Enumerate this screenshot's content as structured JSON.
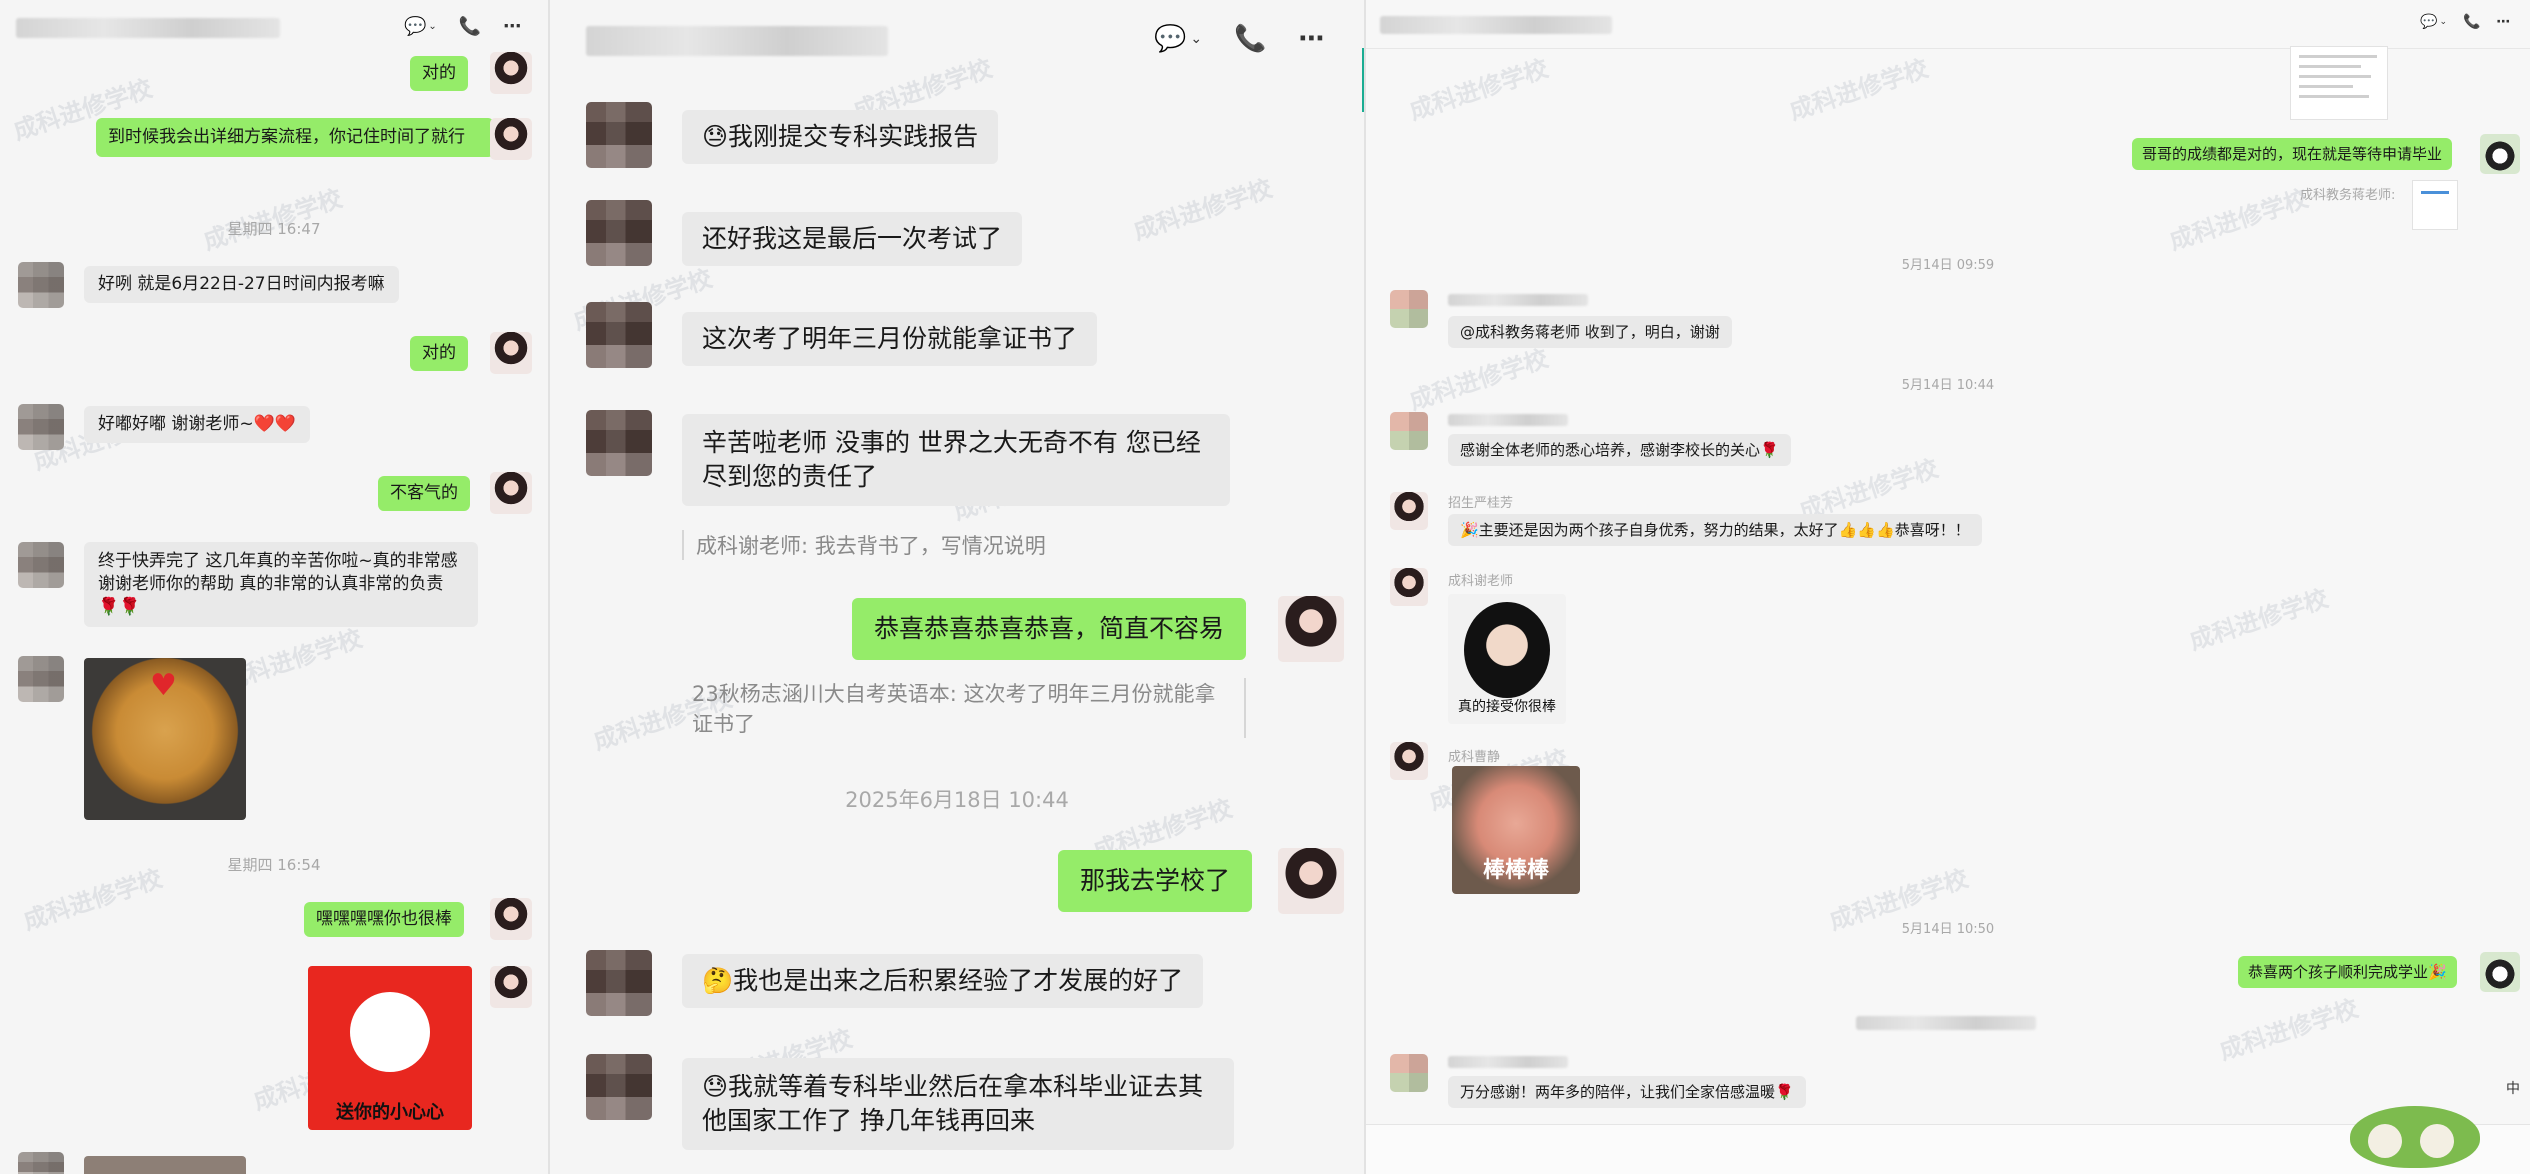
{
  "left_chat": {
    "messages": [
      {
        "dir": "out",
        "text": "对的"
      },
      {
        "dir": "out",
        "text": "到时候我会出详细方案流程，你记住时间了就行"
      },
      {
        "dir": "ts",
        "text": "星期四 16:47"
      },
      {
        "dir": "in",
        "text": "好咧 就是6月22日-27日时间内报考嘛"
      },
      {
        "dir": "out",
        "text": "对的"
      },
      {
        "dir": "in",
        "text": "好嘟好嘟 谢谢老师~❤️❤️"
      },
      {
        "dir": "out",
        "text": "不客气的"
      },
      {
        "dir": "in",
        "text": "终于快弄完了 这几年真的辛苦你啦~真的非常感谢谢老师你的帮助 真的非常的认真非常的负责🌹🌹"
      },
      {
        "dir": "ts",
        "text": "星期四 16:54"
      },
      {
        "dir": "out",
        "text": "嘿嘿嘿嘿你也很棒"
      }
    ],
    "sticker_caption": "送你的小心心"
  },
  "middle_chat": {
    "messages": [
      {
        "dir": "in",
        "text": "😓我刚提交专科实践报告"
      },
      {
        "dir": "in",
        "text": "还好我这是最后一次考试了"
      },
      {
        "dir": "in",
        "text": "这次考了明年三月份就能拿证书了"
      },
      {
        "dir": "in",
        "text": "辛苦啦老师 没事的 世界之大无奇不有 您已经尽到您的责任了"
      },
      {
        "dir": "quote",
        "text": "成科谢老师: 我去背书了，写情况说明"
      },
      {
        "dir": "out",
        "text": "恭喜恭喜恭喜恭喜，简直不容易"
      },
      {
        "dir": "quote",
        "text": "23秋杨志涵川大自考英语本: 这次考了明年三月份就能拿证书了"
      },
      {
        "dir": "ts",
        "text": "2025年6月18日 10:44"
      },
      {
        "dir": "out",
        "text": "那我去学校了"
      },
      {
        "dir": "in",
        "text": "🤔我也是出来之后积累经验了才发展的好了"
      },
      {
        "dir": "in",
        "text": "😓我就等着专科毕业然后在拿本科毕业证去其他国家工作了 挣几年钱再回来"
      }
    ]
  },
  "right_chat": {
    "messages": [
      {
        "dir": "out",
        "text": "哥哥的成绩都是对的，现在就是等待申请毕业"
      },
      {
        "dir": "name",
        "text": "成科教务蒋老师:"
      },
      {
        "dir": "ts",
        "text": "5月14日 09:59"
      },
      {
        "dir": "in",
        "text": "@成科教务蒋老师 收到了，明白，谢谢"
      },
      {
        "dir": "ts",
        "text": "5月14日 10:44"
      },
      {
        "dir": "in",
        "text": "感谢全体老师的悉心培养，感谢李校长的关心🌹"
      },
      {
        "dir": "name",
        "text": "招生严桂芳"
      },
      {
        "dir": "in",
        "text": "🎉主要还是因为两个孩子自身优秀，努力的结果，太好了👍👍👍恭喜呀！！"
      },
      {
        "dir": "name",
        "text": "成科谢老师"
      },
      {
        "dir": "sticker",
        "text": "真的接受你很棒"
      },
      {
        "dir": "name",
        "text": "成科曹静"
      },
      {
        "dir": "sticker",
        "text": "棒棒棒"
      },
      {
        "dir": "ts",
        "text": "5月14日 10:50"
      },
      {
        "dir": "out",
        "text": "恭喜两个孩子顺利完成学业🎉"
      },
      {
        "dir": "in",
        "text": "万分感谢！两年多的陪伴，让我们全家倍感温暖🌹"
      }
    ],
    "ime_indicator": "中"
  },
  "watermark": "成科进修学校",
  "colors": {
    "out_bubble": "#95ec69",
    "in_bubble": "#e9e9e9",
    "timestamp": "#a8a8a8"
  }
}
